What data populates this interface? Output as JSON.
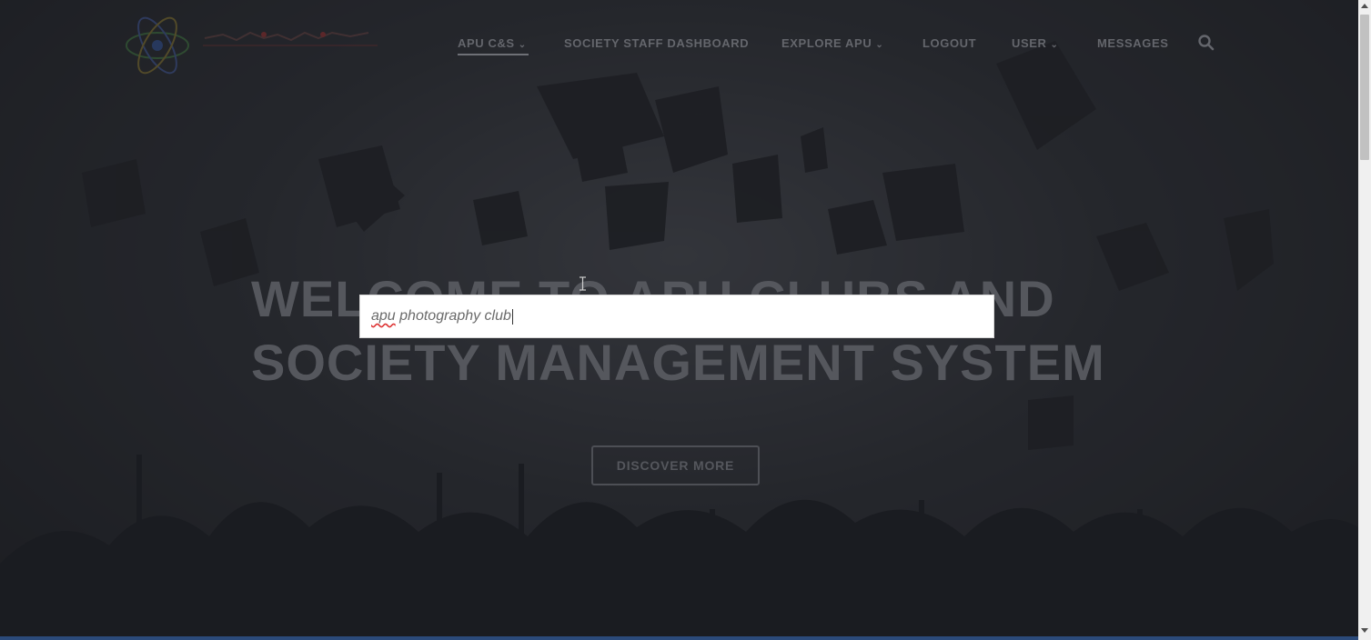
{
  "nav": {
    "items": [
      {
        "label": "APU C&S",
        "dropdown": true,
        "active": true
      },
      {
        "label": "SOCIETY STAFF DASHBOARD",
        "dropdown": false
      },
      {
        "label": "EXPLORE APU",
        "dropdown": true
      },
      {
        "label": "LOGOUT",
        "dropdown": false
      },
      {
        "label": "USER",
        "dropdown": true
      },
      {
        "label": "MESSAGES",
        "dropdown": false
      }
    ],
    "search_icon": "search-icon",
    "chevron_icon": "chevron-down-icon"
  },
  "hero": {
    "title_line1": "WELCOME TO APU CLUBS AND",
    "title_line2": "SOCIETY MANAGEMENT SYSTEM",
    "cta_label": "DISCOVER MORE"
  },
  "search_overlay": {
    "value_word1": "apu",
    "value_rest": " photography club"
  },
  "colors": {
    "overlay": "#1e1f24",
    "nav_text": "#64666c",
    "input_bg": "#ffffff",
    "bottom_bar": "#2b4a7a"
  }
}
